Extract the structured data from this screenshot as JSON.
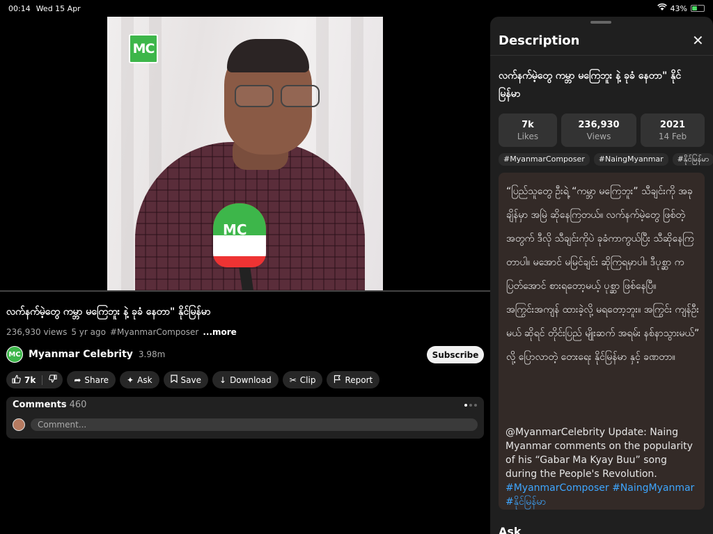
{
  "status": {
    "time": "00:14",
    "date": "Wed 15 Apr",
    "battery": "43%",
    "battery_level": 0.43
  },
  "video": {
    "logo_text": "MC",
    "progress": 0.0,
    "title": "လက်နက်မဲ့တွေ ကမ္ဘာ မကြေဘူး နဲ့ ခုခံ နေတာ\" နိုင်မြန်မာ",
    "views": "236,930 views",
    "age": "5 yr ago",
    "hashtag": "#MyanmarComposer",
    "more_label": "...more"
  },
  "channel": {
    "avatar_text": "MC",
    "name": "Myanmar Celebrity",
    "subscribers": "3.98m",
    "subscribe_label": "Subscribe"
  },
  "actions": {
    "likes": "7k",
    "share": "Share",
    "ask": "Ask",
    "save": "Save",
    "download": "Download",
    "clip": "Clip",
    "report": "Report"
  },
  "comments": {
    "label": "Comments",
    "count": "460",
    "placeholder": "Comment..."
  },
  "panel": {
    "title": "Description",
    "video_title": "လက်နက်မဲ့တွေ ကမ္ဘာ မကြေဘူး နဲ့ ခုခံ နေတာ\" နိုင်မြန်မာ",
    "stats": [
      {
        "value": "7k",
        "label": "Likes"
      },
      {
        "value": "236,930",
        "label": "Views"
      },
      {
        "value": "2021",
        "label": "14 Feb"
      }
    ],
    "tags": [
      "#MyanmarComposer",
      "#NaingMyanmar",
      "#နိုင်မြန်မာ"
    ],
    "description_my": "“ပြည်သူတွေ ဦးရဲ့ “ကမ္ဘာ မကြေဘူး” သီချင်းကို အခုချိန်မှာ အမြဲ ဆိုနေကြတယ်။ လက်နက်မဲ့တွေ ဖြစ်တဲ့ အတွက် ဒီလို သီချင်းကိုပဲ ခုခံကာကွယ်ပြီး သီဆိုနေကြတာပါ။ မအောင် မမြင်ချင်း ဆိုကြရမှာပါ။ ဒီပုစ္ဆာ က ပြတ်အောင် စားရတော့မယ့် ပုစ္ဆာ ဖြစ်နေပြီ။ အကြွင်းအကျန် ထားခဲ့လို့ မရတော့ဘူး။ အကြွင်း ကျန်ဦးမယ် ဆိုရင် တိုင်းပြည် မျိုးဆက် အရမ်း နစ်နာသွားမယ်” လို့ ပြောလာတဲ့ တေးရေး နိုင်မြန်မာ နှင့် ခဏတာ။",
    "description_en": "@MyanmarCelebrity Update: Naing Myanmar comments on the popularity of his “Gabar Ma Kyay Buu” song during the People's Revolution.",
    "links": [
      "#MyanmarComposer",
      "#NaingMyanmar",
      "#နိုင်မြန်မာ"
    ],
    "ask_label": "Ask"
  }
}
